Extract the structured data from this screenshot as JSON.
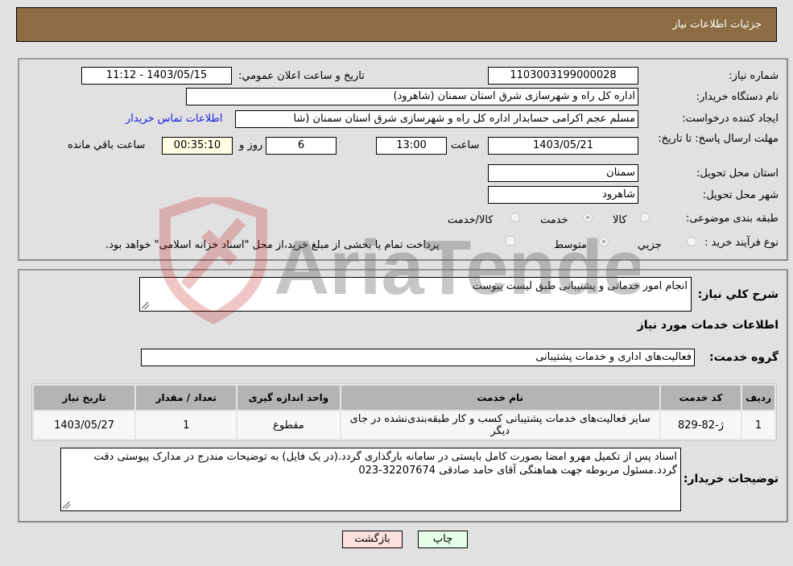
{
  "header": {
    "title": "جزئیات اطلاعات نیاز"
  },
  "details": {
    "need_number_label": "شماره نیاز:",
    "need_number": "1103003199000028",
    "announce_label": "تاریخ و ساعت اعلان عمومي:",
    "announce_value": "1403/05/15 - 11:12",
    "buyer_org_label": "نام دستگاه خریدار:",
    "buyer_org": "اداره کل راه و شهرسازی شرق استان سمنان (شاهرود)",
    "creator_label": "ایجاد کننده درخواست:",
    "creator": "مسلم عجم اکرامی حسابدار اداره کل راه و شهرسازی شرق استان سمنان (شا",
    "buyer_contact_link": "اطلاعات تماس خریدار",
    "deadline_label": "مهلت ارسال پاسخ: تا تاریخ:",
    "deadline_date": "1403/05/21",
    "time_label": "ساعت",
    "deadline_time": "13:00",
    "days_value": "6",
    "days_label": "روز و",
    "remaining_time": "00:35:10",
    "remaining_label": "ساعت باقي مانده",
    "province_label": "استان محل تحویل:",
    "province": "سمنان",
    "city_label": "شهر محل تحویل:",
    "city": "شاهرود",
    "category_label": "طبقه بندی موضوعی:",
    "category_options": [
      {
        "label": "کالا",
        "selected": false
      },
      {
        "label": "خدمت",
        "selected": true
      },
      {
        "label": "کالا/خدمت",
        "selected": false
      }
    ],
    "process_label": "نوع فرآیند خرید :",
    "process_options": [
      {
        "label": "جزيي",
        "selected": false
      },
      {
        "label": "متوسط",
        "selected": true
      }
    ],
    "treasury_checkbox_label": "پرداخت تمام یا بخشی از مبلغ خرید،از محل \"اسناد خزانه اسلامی\" خواهد بود.",
    "treasury_checked": false
  },
  "services": {
    "description_label": "شرح کلي نیاز:",
    "description": "انجام امور خدماتی و پشتیبانی طبق لیست پیوست",
    "section_title": "اطلاعات خدمات مورد نیاز",
    "group_label": "گروه خدمت:",
    "group_value": "فعالیت‌های اداری و خدمات پشتیبانی",
    "table": {
      "headers": [
        "ردیف",
        "کد خدمت",
        "نام خدمت",
        "واحد اندازه گیری",
        "تعداد / مقدار",
        "تاریخ نیاز"
      ],
      "rows": [
        [
          "1",
          "ژ-82-829",
          "سایر فعالیت‌های خدمات پشتیبانی کسب و کار طبقه‌بندی‌نشده در جای دیگر",
          "مقطوع",
          "1",
          "1403/05/27"
        ]
      ]
    },
    "buyer_notes_label": "توضیحات خریدار:",
    "buyer_notes": "اسناد پس از تکمیل مهرو امضا بصورت کامل بایستی در سامانه بارگذاری گردد.(در یک فایل) به توضیحات مندرج در مدارک پیوستی دقت گردد.مسئول مربوطه جهت هماهنگی آقای حامد صادقی 32207674-023"
  },
  "buttons": {
    "print": "چاپ",
    "back": "بازگشت"
  },
  "watermark": {
    "text": "AriaTender.neT"
  },
  "colors": {
    "header_bg": "#8c6d43",
    "link": "#1a1adb",
    "back_btn": "#ffe0e0",
    "print_btn": "#e6ffe6"
  }
}
